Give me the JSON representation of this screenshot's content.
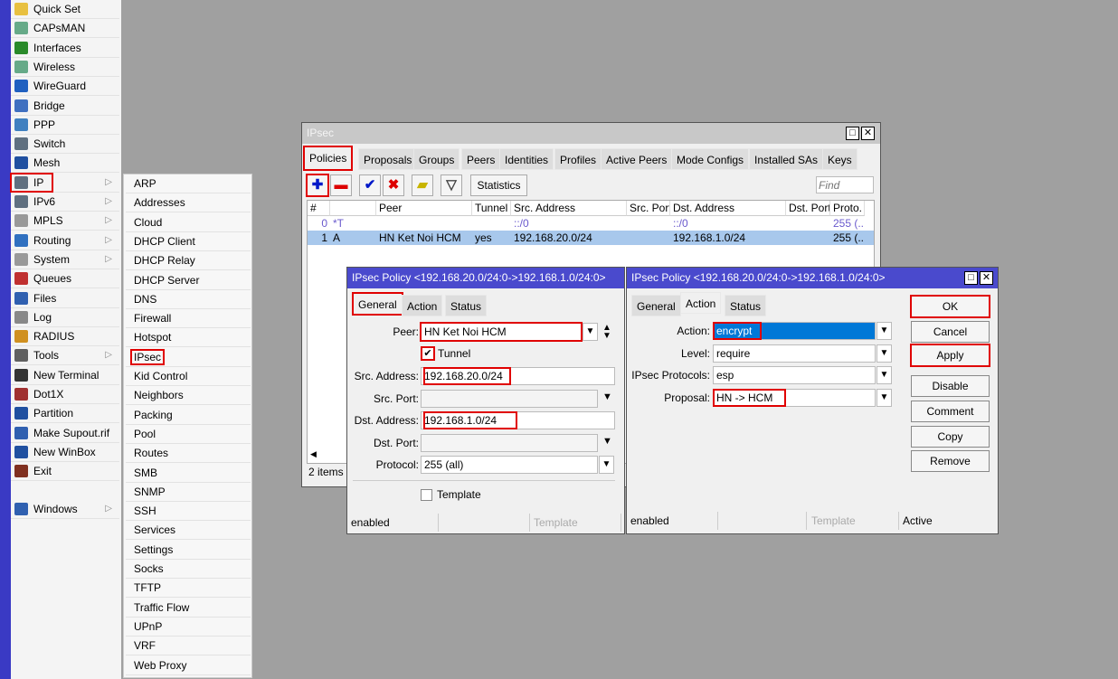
{
  "menu": [
    {
      "label": "Quick Set",
      "icon": "wand-icon"
    },
    {
      "label": "CAPsMAN",
      "icon": "antenna-icon"
    },
    {
      "label": "Interfaces",
      "icon": "interfaces-icon"
    },
    {
      "label": "Wireless",
      "icon": "antenna-icon"
    },
    {
      "label": "WireGuard",
      "icon": "wireguard-icon"
    },
    {
      "label": "Bridge",
      "icon": "bridge-icon"
    },
    {
      "label": "PPP",
      "icon": "ppp-icon"
    },
    {
      "label": "Switch",
      "icon": "switch-icon"
    },
    {
      "label": "Mesh",
      "icon": "mesh-icon"
    },
    {
      "label": "IP",
      "icon": "ip-icon",
      "sub": true
    },
    {
      "label": "IPv6",
      "icon": "ipv6-icon",
      "sub": true
    },
    {
      "label": "MPLS",
      "icon": "mpls-icon",
      "sub": true
    },
    {
      "label": "Routing",
      "icon": "routing-icon",
      "sub": true
    },
    {
      "label": "System",
      "icon": "gear-icon",
      "sub": true
    },
    {
      "label": "Queues",
      "icon": "queues-icon"
    },
    {
      "label": "Files",
      "icon": "folder-icon"
    },
    {
      "label": "Log",
      "icon": "log-icon"
    },
    {
      "label": "RADIUS",
      "icon": "radius-icon"
    },
    {
      "label": "Tools",
      "icon": "tools-icon",
      "sub": true
    },
    {
      "label": "New Terminal",
      "icon": "terminal-icon"
    },
    {
      "label": "Dot1X",
      "icon": "dot1x-icon"
    },
    {
      "label": "Partition",
      "icon": "partition-icon"
    },
    {
      "label": "Make Supout.rif",
      "icon": "supout-icon"
    },
    {
      "label": "New WinBox",
      "icon": "winbox-icon"
    },
    {
      "label": "Exit",
      "icon": "exit-icon"
    },
    {
      "label": "Windows",
      "icon": "windows-icon",
      "sub": true
    }
  ],
  "submenu": [
    "ARP",
    "Addresses",
    "Cloud",
    "DHCP Client",
    "DHCP Relay",
    "DHCP Server",
    "DNS",
    "Firewall",
    "Hotspot",
    "IPsec",
    "Kid Control",
    "Neighbors",
    "Packing",
    "Pool",
    "Routes",
    "SMB",
    "SNMP",
    "SSH",
    "Services",
    "Settings",
    "Socks",
    "TFTP",
    "Traffic Flow",
    "UPnP",
    "VRF",
    "Web Proxy"
  ],
  "ipsec": {
    "title": "IPsec",
    "tabs": [
      "Policies",
      "Proposals",
      "Groups",
      "Peers",
      "Identities",
      "Profiles",
      "Active Peers",
      "Mode Configs",
      "Installed SAs",
      "Keys"
    ],
    "statistics": "Statistics",
    "find_placeholder": "Find",
    "columns": [
      "#",
      "",
      "Peer",
      "Tunnel",
      "Src. Address",
      "Src. Port",
      "Dst. Address",
      "Dst. Port",
      "Proto."
    ],
    "rows": [
      [
        "0",
        "*T",
        "",
        "",
        "::/0",
        "",
        "::/0",
        "",
        "255 (..."
      ],
      [
        "1",
        "A",
        "HN Ket Noi HCM",
        "yes",
        "192.168.20.0/24",
        "",
        "192.168.1.0/24",
        "",
        "255 (..."
      ]
    ],
    "status": "2 items ("
  },
  "policy1": {
    "title": "IPsec Policy <192.168.20.0/24:0->192.168.1.0/24:0>",
    "tabs": [
      "General",
      "Action",
      "Status"
    ],
    "peer_label": "Peer:",
    "peer": "HN Ket Noi HCM",
    "tunnel": "Tunnel",
    "src_label": "Src. Address:",
    "src": "192.168.20.0/24",
    "srcport_label": "Src. Port:",
    "dst_label": "Dst. Address:",
    "dst": "192.168.1.0/24",
    "dstport_label": "Dst. Port:",
    "proto_label": "Protocol:",
    "proto": "255 (all)",
    "template": "Template",
    "status": [
      "enabled",
      "",
      "Template"
    ]
  },
  "policy2": {
    "title": "IPsec Policy <192.168.20.0/24:0->192.168.1.0/24:0>",
    "tabs": [
      "General",
      "Action",
      "Status"
    ],
    "action_label": "Action:",
    "action": "encrypt",
    "level_label": "Level:",
    "level": "require",
    "protocols_label": "IPsec Protocols:",
    "protocols": "esp",
    "proposal_label": "Proposal:",
    "proposal": "HN -> HCM",
    "buttons": [
      "OK",
      "Cancel",
      "Apply",
      "Disable",
      "Comment",
      "Copy",
      "Remove"
    ],
    "status": [
      "enabled",
      "",
      "Template",
      "Active"
    ]
  },
  "colors": {
    "highlight": "#e00000",
    "title_active": "#4a4acd",
    "selection": "#0078d7",
    "row_selected": "#a8c8ec"
  }
}
